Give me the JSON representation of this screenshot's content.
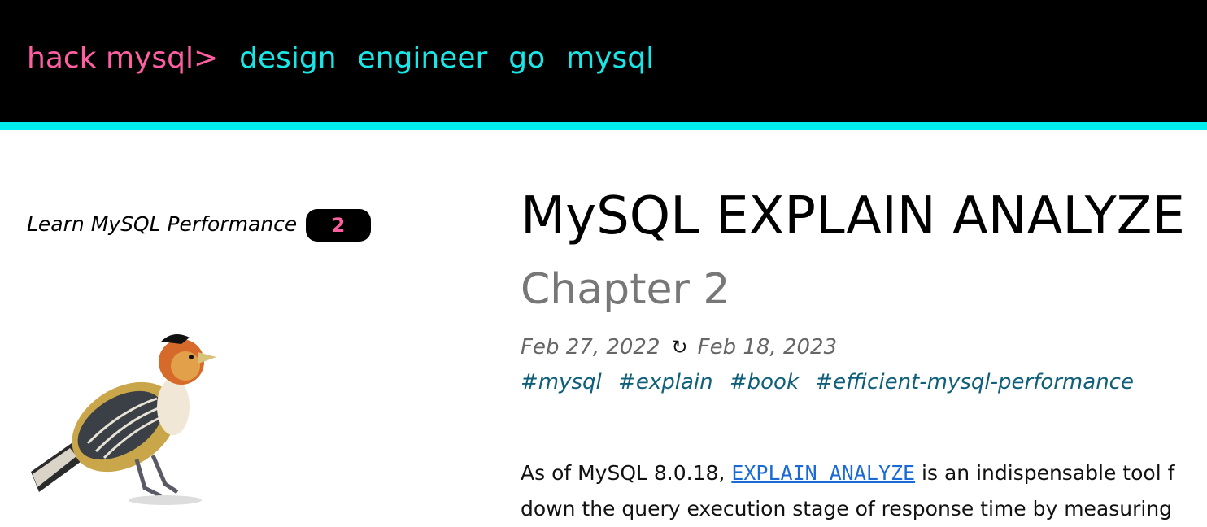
{
  "nav": {
    "brand": "hack mysql>",
    "links": [
      "design",
      "engineer",
      "go",
      "mysql"
    ]
  },
  "sidebar": {
    "label": "Learn MySQL Performance",
    "chapter_number": "2"
  },
  "article": {
    "title": "MySQL EXPLAIN ANALYZE",
    "subtitle": "Chapter 2",
    "published": "Feb 27, 2022",
    "updated": "Feb 18, 2023",
    "tags": [
      "#mysql",
      "#explain",
      "#book",
      "#efficient-mysql-performance"
    ],
    "paragraph": {
      "lead": "As of MySQL 8.0.18, ",
      "code_link": "EXPLAIN ANALYZE",
      "tail": " is an indispensable tool f",
      "line2": "down the query execution stage of response time by measuring"
    }
  },
  "colors": {
    "brand": "#ff5fa2",
    "nav_link": "#19e6e6",
    "accent_bar": "#00eeee",
    "tag": "#0f5f7a",
    "code_link": "#1a6ad6"
  },
  "icons": {
    "updated": "refresh-icon"
  }
}
